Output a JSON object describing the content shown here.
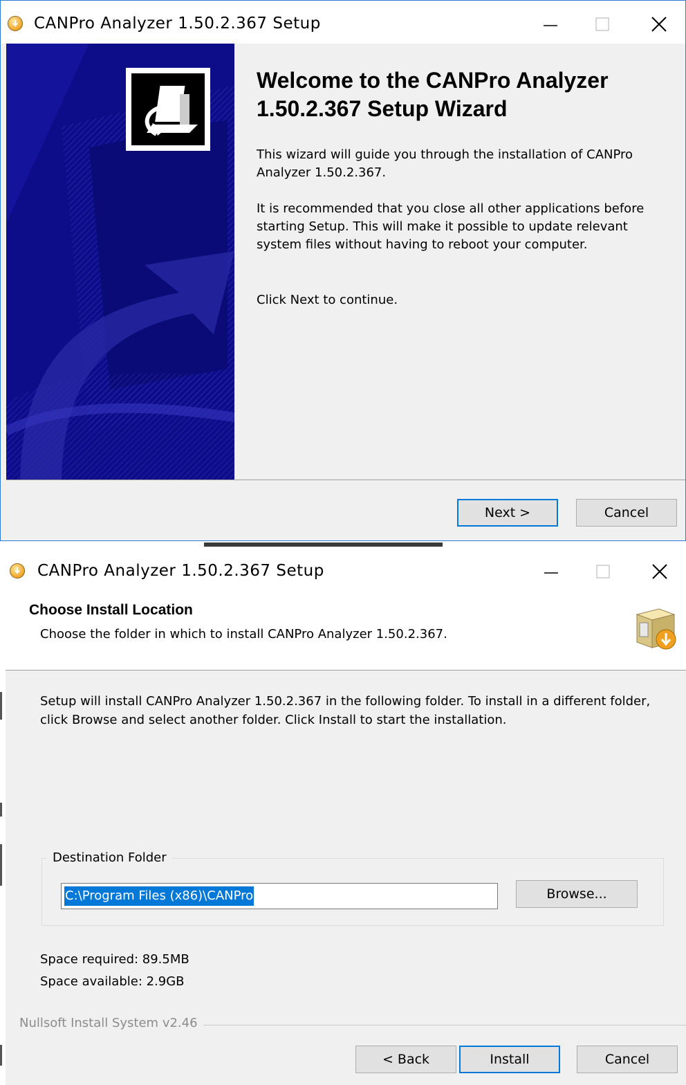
{
  "window1": {
    "title": "CANPro Analyzer 1.50.2.367 Setup",
    "welcome_title": "Welcome to the CANPro Analyzer 1.50.2.367 Setup Wizard",
    "paragraphs": [
      "This wizard will guide you through the installation of CANPro Analyzer 1.50.2.367.",
      "It is recommended that you close all other applications before starting Setup. This will make it possible to update relevant system files without having to reboot your computer.",
      "Click Next to continue."
    ],
    "next_label": "Next >",
    "cancel_label": "Cancel"
  },
  "window2": {
    "title": "CANPro Analyzer 1.50.2.367 Setup",
    "header_title": "Choose Install Location",
    "header_subtitle": "Choose the folder in which to install CANPro Analyzer 1.50.2.367.",
    "body_text": "Setup will install CANPro Analyzer 1.50.2.367 in the following folder. To install in a different folder, click Browse and select another folder. Click Install to start the installation.",
    "destination_label": "Destination Folder",
    "destination_value": "C:\\Program Files (x86)\\CANPro",
    "browse_label": "Browse...",
    "space_required": "Space required: 89.5MB",
    "space_available": "Space available: 2.9GB",
    "branding": "Nullsoft Install System v2.46",
    "back_label": "< Back",
    "install_label": "Install",
    "cancel_label": "Cancel"
  },
  "colors": {
    "banner": "#0d0d8a",
    "accent": "#0078d7",
    "dialog_bg": "#f0f0f0"
  },
  "icons": [
    "installer-app-icon",
    "minimize-icon",
    "maximize-icon",
    "close-icon",
    "installer-logo-icon",
    "box-install-icon"
  ]
}
